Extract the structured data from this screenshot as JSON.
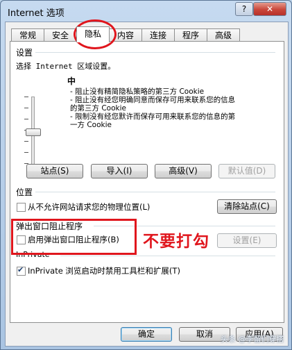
{
  "window": {
    "title": "Internet 选项",
    "help_label": "?",
    "close_label": "✕"
  },
  "tabs": [
    "常规",
    "安全",
    "隐私",
    "内容",
    "连接",
    "程序",
    "高级"
  ],
  "settings": {
    "heading": "设置",
    "zone_text": "选择 Internet 区域设置。",
    "level": "中",
    "bullets": [
      [
        "- 阻止没有精简隐私策略的第三方 Cookie"
      ],
      [
        "- 阻止没有经您明确同意而保存可用来联系您的信息",
        "的第三方 Cookie"
      ],
      [
        "- 限制没有经您默许而保存可用来联系您的信息的第",
        "一方 Cookie"
      ]
    ],
    "buttons": {
      "sites": "站点(S)",
      "import": "导入(I)",
      "advanced": "高级(V)",
      "default": "默认值(D)"
    }
  },
  "location": {
    "heading": "位置",
    "checkbox_label": "从不允许网站请求您的物理位置(L)",
    "checked": false,
    "clear_button": "清除站点(C)"
  },
  "popup": {
    "heading": "弹出窗口阻止程序",
    "checkbox_label": "启用弹出窗口阻止程序(B)",
    "checked": false,
    "settings_button": "设置(E)"
  },
  "inprivate": {
    "heading": "InPrivate",
    "checkbox_label": "InPrivate 浏览启动时禁用工具栏和扩展(T)",
    "checked": true
  },
  "footer": {
    "ok": "确定",
    "cancel": "取消",
    "apply": "应用(A)"
  },
  "annotation": "不要打勾",
  "watermark": "头条 @李留们穿搭",
  "colors": {
    "annotation_red": "#e0161d"
  }
}
